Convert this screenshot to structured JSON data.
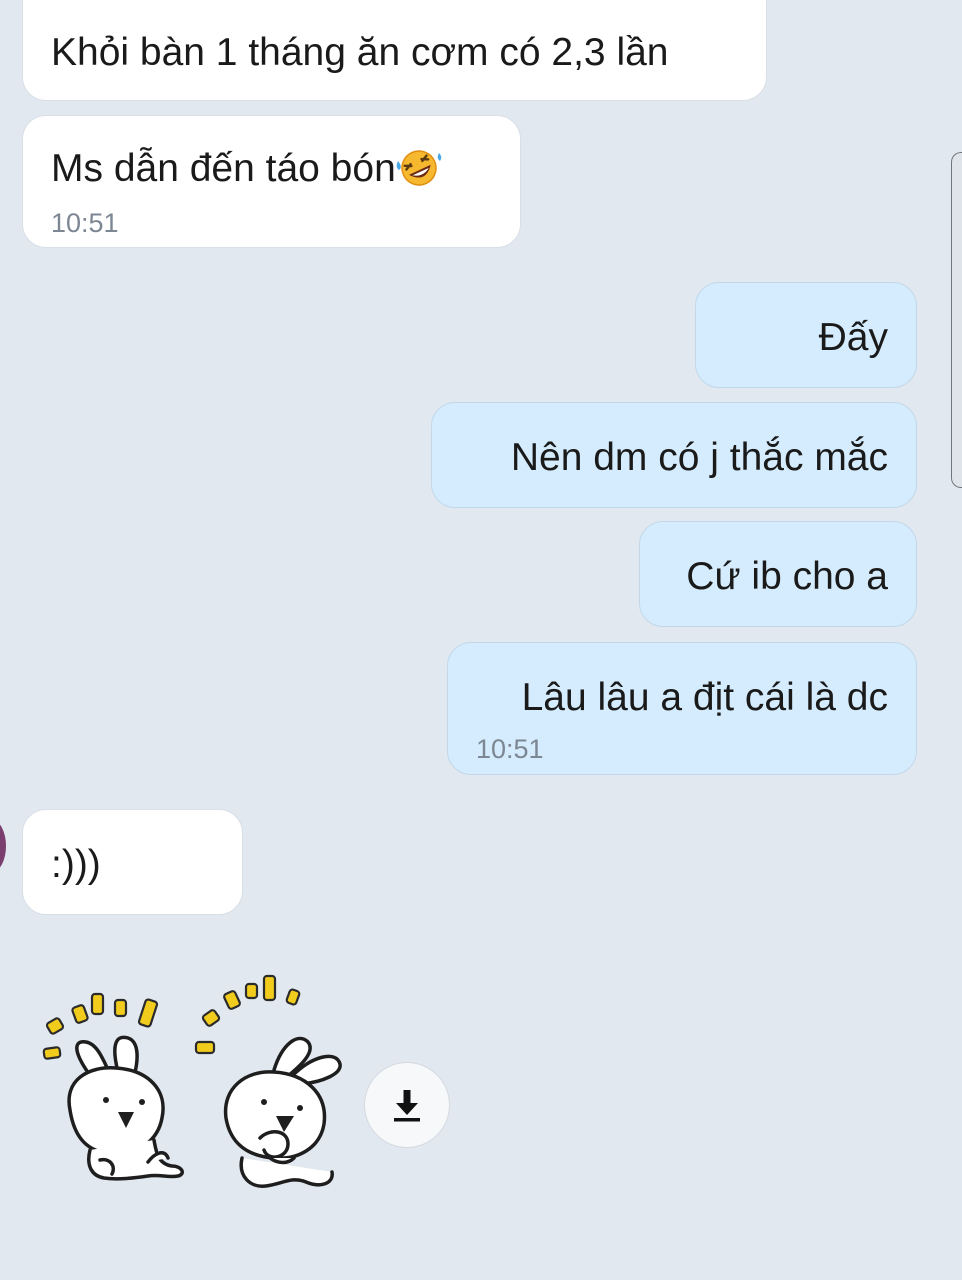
{
  "chat": {
    "messages": [
      {
        "id": 1,
        "direction": "incoming",
        "text": "Khỏi bàn 1 tháng ăn cơm có 2,3 lần",
        "time": null
      },
      {
        "id": 2,
        "direction": "incoming",
        "text": "Ms dẫn đến táo bón",
        "emoji": "rolling-on-floor-laughing-emoji",
        "time": "10:51"
      },
      {
        "id": 3,
        "direction": "outgoing",
        "text": "Đấy",
        "time": null
      },
      {
        "id": 4,
        "direction": "outgoing",
        "text": "Nên dm có j thắc mắc",
        "time": null
      },
      {
        "id": 5,
        "direction": "outgoing",
        "text": "Cứ ib cho a",
        "time": null
      },
      {
        "id": 6,
        "direction": "outgoing",
        "text": "Lâu lâu a địt cái là dc",
        "time": "10:51"
      },
      {
        "id": 7,
        "direction": "incoming",
        "text": ":)))",
        "time": null
      }
    ],
    "sticker": {
      "icon": "two-bunnies-cheering-sticker"
    },
    "download_icon": "download-arrow-icon"
  },
  "colors": {
    "background": "#e1e8f0",
    "incoming_bubble": "#ffffff",
    "outgoing_bubble": "#d4ecfd",
    "timestamp": "#7c8793",
    "sparkle": "#f2cc1d",
    "avatar": "#7a3f6f"
  }
}
